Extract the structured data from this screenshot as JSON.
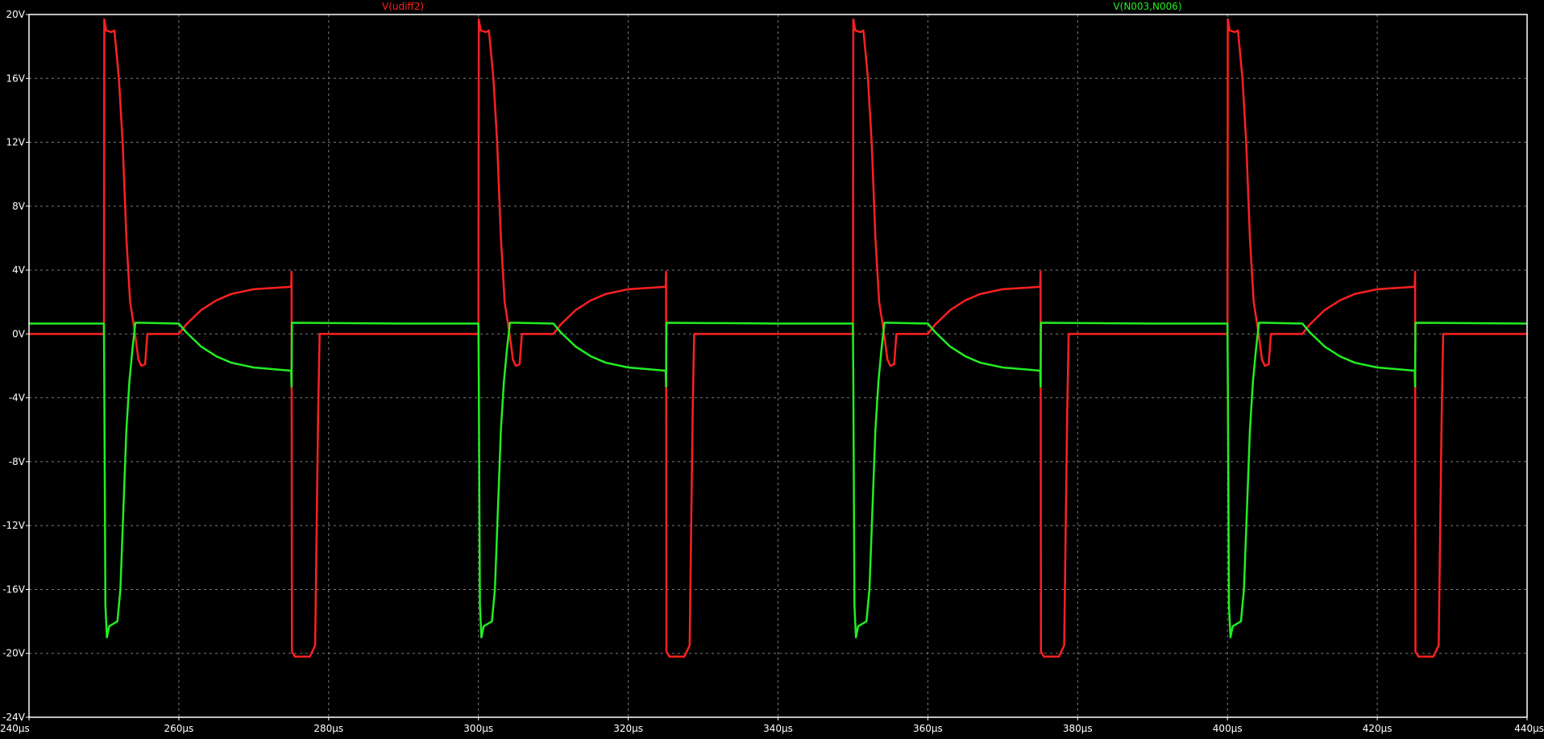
{
  "chart_data": {
    "type": "line",
    "title": "",
    "xlabel": "",
    "ylabel": "",
    "xlim": [
      240,
      440
    ],
    "ylim": [
      -24,
      20
    ],
    "x_unit": "µs",
    "y_unit": "V",
    "grid": true,
    "background": "#000000",
    "legend_position": "top",
    "x_ticks": [
      "240µs",
      "260µs",
      "280µs",
      "300µs",
      "320µs",
      "340µs",
      "360µs",
      "380µs",
      "400µs",
      "420µs",
      "440µs"
    ],
    "y_ticks": [
      "20V",
      "16V",
      "12V",
      "8V",
      "4V",
      "0V",
      "-4V",
      "-8V",
      "-12V",
      "-16V",
      "-20V",
      "-24V"
    ],
    "series": [
      {
        "name": "V(udiff2)",
        "color": "#ff2020",
        "period": 50,
        "cycle": [
          [
            0,
            0
          ],
          [
            10,
            0
          ],
          [
            10.05,
            19.7
          ],
          [
            10.3,
            19
          ],
          [
            11,
            18.9
          ],
          [
            11.4,
            19
          ],
          [
            12,
            16
          ],
          [
            12.5,
            12
          ],
          [
            13,
            6
          ],
          [
            13.5,
            2
          ],
          [
            14,
            0.5
          ],
          [
            14.3,
            -0.5
          ],
          [
            14.6,
            -1.6
          ],
          [
            15,
            -2
          ],
          [
            15.5,
            -1.9
          ],
          [
            15.8,
            0
          ],
          [
            20,
            0
          ],
          [
            21,
            0.6
          ],
          [
            23,
            1.5
          ],
          [
            25,
            2.1
          ],
          [
            27,
            2.5
          ],
          [
            30,
            2.8
          ],
          [
            35,
            2.95
          ],
          [
            35.05,
            3.9
          ],
          [
            35.1,
            -19.9
          ],
          [
            35.5,
            -20.2
          ],
          [
            37.5,
            -20.2
          ],
          [
            38.2,
            -19.5
          ],
          [
            38.6,
            -5
          ],
          [
            38.8,
            0
          ],
          [
            50,
            0
          ]
        ]
      },
      {
        "name": "V(N003,N006)",
        "color": "#22ee22",
        "period": 50,
        "cycle": [
          [
            0,
            0.65
          ],
          [
            10,
            0.65
          ],
          [
            10.05,
            -3
          ],
          [
            10.2,
            -17
          ],
          [
            10.4,
            -19
          ],
          [
            10.7,
            -18.3
          ],
          [
            11.8,
            -18
          ],
          [
            12.2,
            -16
          ],
          [
            12.6,
            -11
          ],
          [
            13,
            -6
          ],
          [
            13.4,
            -3
          ],
          [
            13.8,
            -1
          ],
          [
            14.2,
            0.7
          ],
          [
            15,
            0.7
          ],
          [
            20,
            0.65
          ],
          [
            21,
            0.1
          ],
          [
            23,
            -0.8
          ],
          [
            25,
            -1.4
          ],
          [
            27,
            -1.8
          ],
          [
            30,
            -2.1
          ],
          [
            35,
            -2.3
          ],
          [
            35.05,
            -3.3
          ],
          [
            35.1,
            0.7
          ],
          [
            50,
            0.65
          ]
        ]
      }
    ]
  }
}
